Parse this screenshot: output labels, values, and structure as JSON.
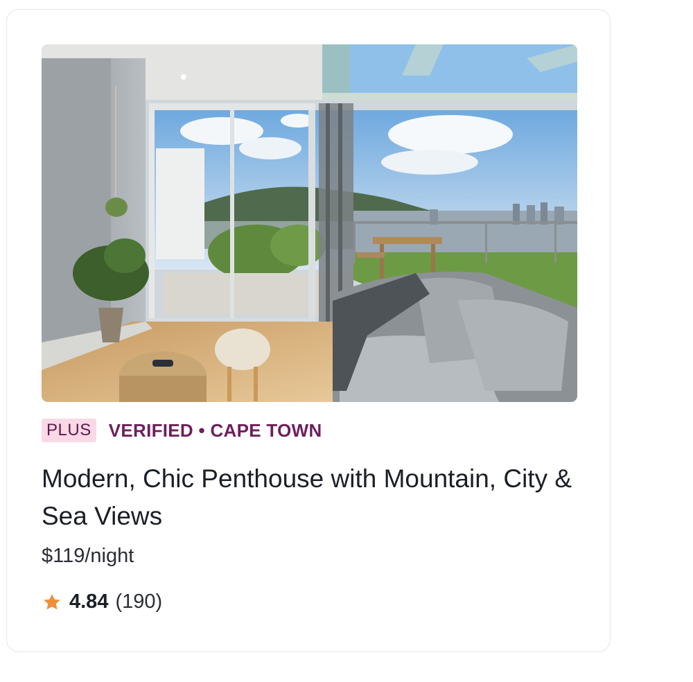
{
  "listing": {
    "photo": {
      "alt": "Modern, Chic Penthouse with Mountain, City & Sea Views"
    },
    "plus_label": "PLUS",
    "category": "VERIFIED • CAPE TOWN",
    "title": "Modern, Chic Penthouse with Mountain, City & Sea Views",
    "price": "$119/night",
    "rating": {
      "score": "4.84",
      "count": "(190)",
      "star_color": "#ef8f3a"
    }
  },
  "colors": {
    "plus_badge_bg": "#fbd8e6",
    "category_text": "#6e1e5d",
    "card_border": "#e3e5ea"
  }
}
